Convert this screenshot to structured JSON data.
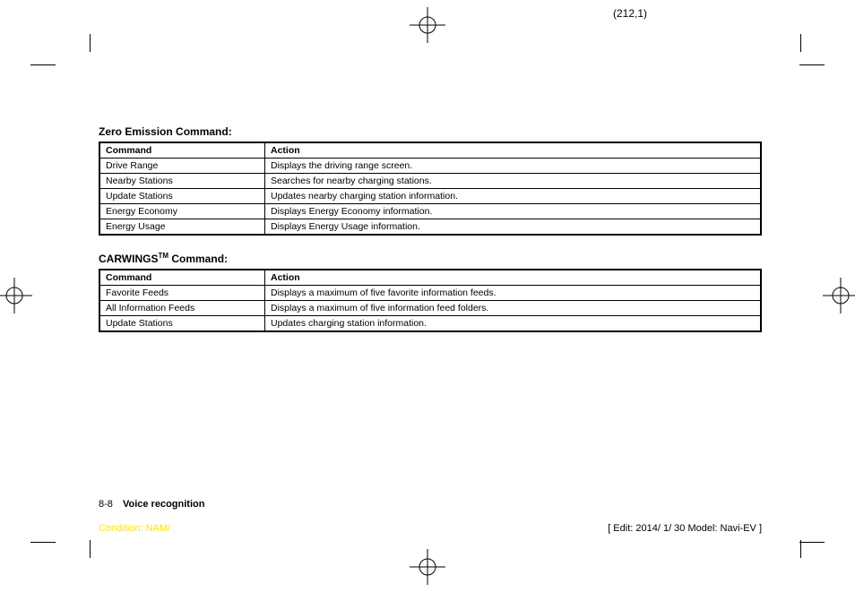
{
  "page_coord": "(212,1)",
  "sections": [
    {
      "title_html": "Zero Emission Command:",
      "headers": [
        "Command",
        "Action"
      ],
      "rows": [
        [
          "Drive Range",
          "Displays the driving range screen."
        ],
        [
          "Nearby Stations",
          "Searches for nearby charging stations."
        ],
        [
          "Update Stations",
          "Updates nearby charging station information."
        ],
        [
          "Energy Economy",
          "Displays Energy Economy information."
        ],
        [
          "Energy Usage",
          "Displays Energy Usage information."
        ]
      ]
    },
    {
      "title_prefix": "CARWINGS",
      "title_sup": "TM",
      "title_suffix": " Command:",
      "headers": [
        "Command",
        "Action"
      ],
      "rows": [
        [
          "Favorite Feeds",
          "Displays a maximum of five favorite information feeds."
        ],
        [
          "All Information Feeds",
          "Displays a maximum of five information feed folders."
        ],
        [
          "Update Stations",
          "Updates charging station information."
        ]
      ]
    }
  ],
  "footer": {
    "page_num": "8-8",
    "section_name": "Voice recognition",
    "condition": "Condition: NAM/",
    "edit_info": "[ Edit: 2014/ 1/ 30   Model: Navi-EV ]"
  }
}
